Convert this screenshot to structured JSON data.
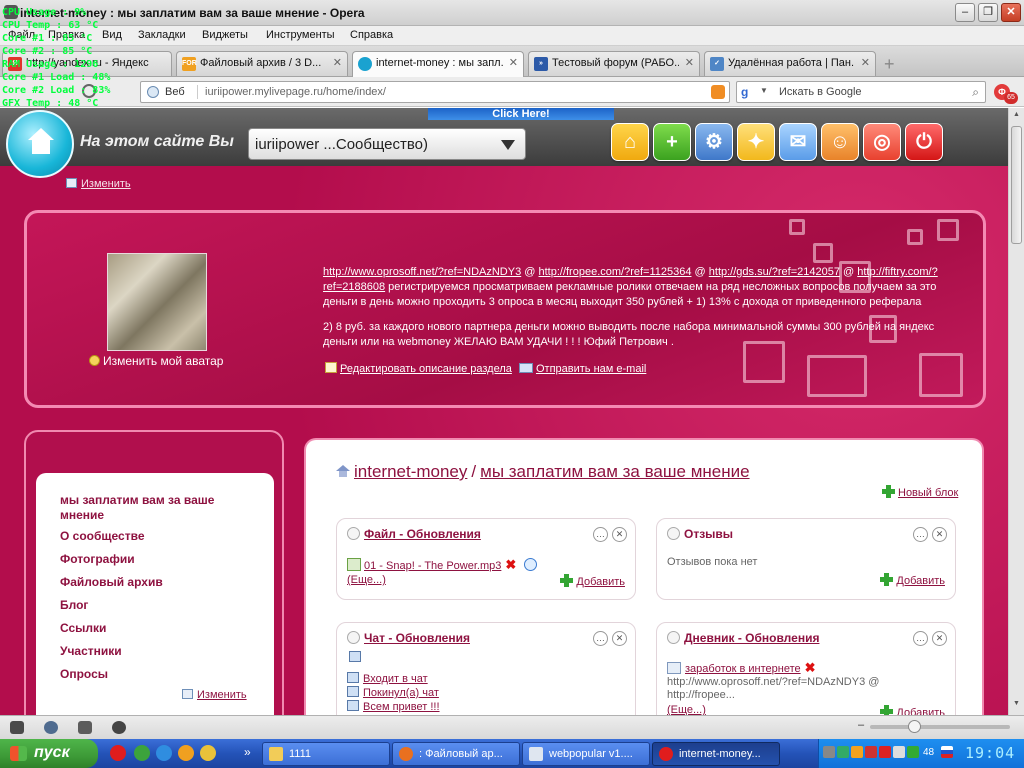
{
  "window": {
    "title": "internet-money : мы заплатим вам за ваше мнение - Opera"
  },
  "overlay": {
    "lines": [
      "CPU Usage : 9%",
      "CPU Temp : 63 °C",
      "Core #1 : 85 °C",
      "Core #2 : 85 °C",
      "RAM Usage : 1296",
      "Core #1 Load : 48%",
      "Core #2 Load : 83%",
      "GFX Temp : 48 °C"
    ]
  },
  "menu": [
    "Файл",
    "Правка",
    "Вид",
    "Закладки",
    "Виджеты",
    "Инструменты",
    "Справка"
  ],
  "tabs": [
    {
      "label": "http://yandex.ru - Яндекс",
      "active": false
    },
    {
      "label": "Файловый архив / 3 D...",
      "active": false
    },
    {
      "label": "internet-money : мы запл...",
      "active": true
    },
    {
      "label": "Тестовый форум (РАБО...",
      "active": false
    },
    {
      "label": "Удалённая работа | Пан...",
      "active": false
    }
  ],
  "address": {
    "prefix": "Веб",
    "url": "iuriipower.mylivepage.ru/home/index/",
    "search_placeholder": "Искать в Google",
    "badge_count": "65"
  },
  "site": {
    "banner_text": "Click Here!",
    "title": "На этом сайте Вы",
    "community_select": "iuriipower ...Сообщество)",
    "edit_link": "Изменить"
  },
  "header": {
    "avatar_link": "Изменить мой аватар",
    "text_links": [
      "http://www.oprosoff.net/?ref=NDAzNDY3",
      "http://fropee.com/?ref=1125364",
      "http://gds.su/?ref=2142057",
      "http://fiftry.com/?ref=2188608"
    ],
    "text_rest": "регистрируемся просматриваем рекламные ролики отвечаем на ряд несложных вопросов получаем за это деньги в день можно проходить 3 опроса в месяц выходит 350 рублей + 1) 13% с дохода от приведенного реферала",
    "text_p2": "2) 8 руб. за каждого нового партнера деньги можно выводить после набора минимальной суммы 300 рублей на яндекс деньги или на webmoney ЖЕЛАЮ ВАМ УДАЧИ ! ! ! Юфий Петрович .",
    "edit_section": "Редактировать описание раздела",
    "send_email": "Отправить нам e-mail"
  },
  "sidebar": {
    "items": [
      "мы заплатим вам за ваше мнение",
      "О сообществе",
      "Фотографии",
      "Файловый архив",
      "Блог",
      "Ссылки",
      "Участники",
      "Опросы"
    ],
    "edit": "Изменить"
  },
  "main": {
    "crumb_community": "internet-money",
    "crumb_page": "мы заплатим вам за ваше мнение",
    "new_block": "Новый блок",
    "blocks": {
      "files": {
        "title": "Файл - Обновления",
        "item": "01 - Snap! - The Power.mp3",
        "more": "(Еще...)",
        "add": "Добавить"
      },
      "reviews": {
        "title": "Отзывы",
        "empty": "Отзывов пока нет",
        "add": "Добавить"
      },
      "chat": {
        "title": "Чат - Обновления",
        "items": [
          "Входит в чат",
          "Покинул(а) чат",
          "Всем привет !!!"
        ]
      },
      "diary": {
        "title": "Дневник - Обновления",
        "entry": "заработок в интернете",
        "preview": "http://www.oprosoff.net/?ref=NDAzNDY3 @ http://fropee...",
        "more": "(Еще...)",
        "add": "Добавить"
      }
    }
  },
  "taskbar": {
    "start": "пуск",
    "buttons": [
      "1111",
      ": Файловый ар...",
      "webpopular v1....",
      "internet-money..."
    ],
    "tray_lang": "48",
    "clock": "19:04"
  }
}
